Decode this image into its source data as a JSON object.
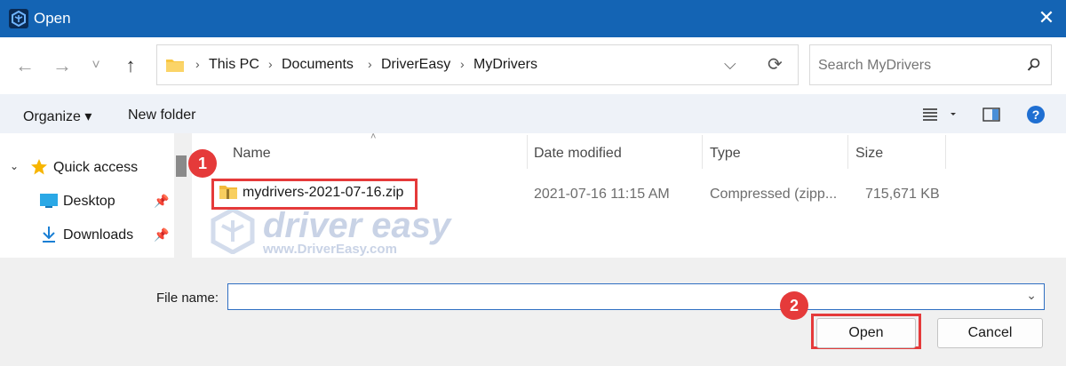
{
  "window": {
    "title": "Open",
    "close_glyph": "✕"
  },
  "nav": {
    "back_glyph": "←",
    "forward_glyph": "→",
    "recent_glyph": "˅",
    "up_glyph": "↑",
    "breadcrumb": [
      "This PC",
      "Documents",
      "DriverEasy",
      "MyDrivers"
    ],
    "separator": "›",
    "dropdown_glyph": "⌵",
    "refresh_glyph": "⟳"
  },
  "search": {
    "placeholder": "Search MyDrivers"
  },
  "toolbar": {
    "organize": "Organize ▾",
    "new_folder": "New folder"
  },
  "columns": {
    "name": "Name",
    "date": "Date modified",
    "type": "Type",
    "size": "Size"
  },
  "sidebar": {
    "items": [
      {
        "label": "Quick access"
      },
      {
        "label": "Desktop"
      },
      {
        "label": "Downloads"
      }
    ]
  },
  "files": [
    {
      "name": "mydrivers-2021-07-16.zip",
      "date": "2021-07-16 11:15 AM",
      "type": "Compressed (zipp...",
      "size": "715,671 KB"
    }
  ],
  "watermark": {
    "brand": "driver easy",
    "url": "www.DriverEasy.com"
  },
  "bottom": {
    "file_name_label": "File name:",
    "file_name_value": "",
    "open_label": "Open",
    "cancel_label": "Cancel"
  },
  "annotations": {
    "step1": "1",
    "step2": "2",
    "accent_color": "#e53a3a"
  }
}
